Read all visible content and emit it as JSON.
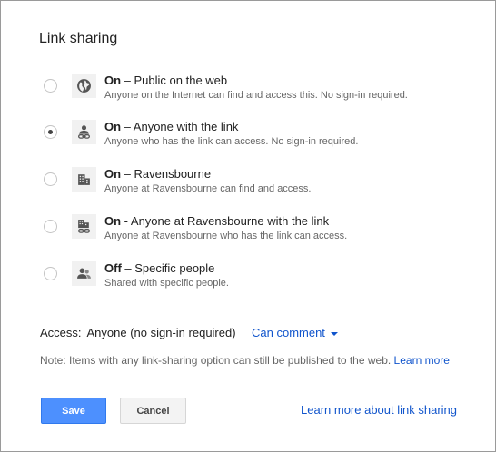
{
  "dialog": {
    "title": "Link sharing"
  },
  "options": [
    {
      "state": "On",
      "rest": " – Public on the web",
      "desc": "Anyone on the Internet can find and access this. No sign-in required.",
      "icon": "globe-icon",
      "selected": false
    },
    {
      "state": "On",
      "rest": " – Anyone with the link",
      "desc": "Anyone who has the link can access. No sign-in required.",
      "icon": "person-link-icon",
      "selected": true
    },
    {
      "state": "On",
      "rest": " – Ravensbourne",
      "desc": "Anyone at Ravensbourne can find and access.",
      "icon": "building-icon",
      "selected": false
    },
    {
      "state": "On",
      "rest": " - Anyone at Ravensbourne with the link",
      "desc": "Anyone at Ravensbourne who has the link can access.",
      "icon": "building-link-icon",
      "selected": false
    },
    {
      "state": "Off",
      "rest": " – Specific people",
      "desc": "Shared with specific people.",
      "icon": "people-icon",
      "selected": false
    }
  ],
  "access": {
    "label": "Access:",
    "value": "Anyone (no sign-in required)",
    "dropdown": "Can comment"
  },
  "note": {
    "text": "Note: Items with any link-sharing option can still be published to the web. ",
    "link": "Learn more"
  },
  "buttons": {
    "save": "Save",
    "cancel": "Cancel"
  },
  "footer_link": "Learn more about link sharing",
  "colors": {
    "accent": "#4d90fe",
    "link": "#1155cc"
  }
}
